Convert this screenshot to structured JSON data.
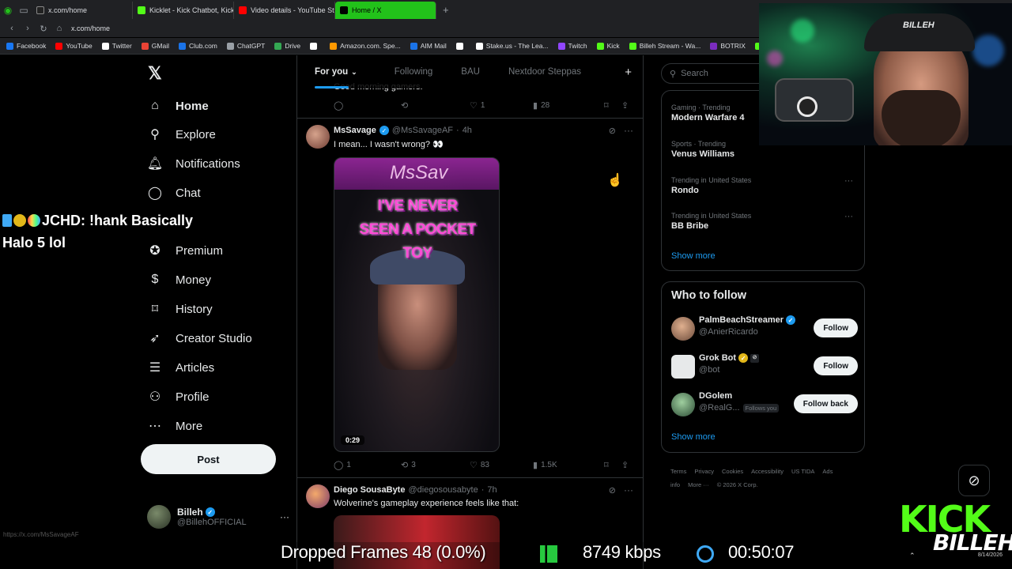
{
  "browser": {
    "tabs": [
      {
        "label": "x.com/home",
        "color": "#9aa0a6"
      },
      {
        "label": "Kicklet - Kick Chatbot, Kick",
        "color": "#53fc18"
      },
      {
        "label": "Video details - YouTube Stu",
        "color": "#ff0000"
      },
      {
        "label": "Home / X",
        "color": "#000000",
        "active": true
      }
    ],
    "url": "x.com/home",
    "bookmarks": [
      {
        "label": "Facebook",
        "color": "#1877f2"
      },
      {
        "label": "YouTube",
        "color": "#ff0000"
      },
      {
        "label": "Twitter",
        "color": "#ffffff"
      },
      {
        "label": "GMail",
        "color": "#ea4335"
      },
      {
        "label": "Club.com",
        "color": "#1a73e8"
      },
      {
        "label": "ChatGPT",
        "color": "#9aa0a6"
      },
      {
        "label": "Drive",
        "color": "#34a853"
      },
      {
        "label": "",
        "color": "#ffffff"
      },
      {
        "label": "Amazon.com. Spe...",
        "color": "#ff9900"
      },
      {
        "label": "AIM Mail",
        "color": "#1a73e8"
      },
      {
        "label": "",
        "color": "#ffffff"
      },
      {
        "label": "Stake.us - The Lea...",
        "color": "#ffffff"
      },
      {
        "label": "Twitch",
        "color": "#9146ff"
      },
      {
        "label": "Kick",
        "color": "#53fc18"
      },
      {
        "label": "Billeh Stream - Wa...",
        "color": "#53fc18"
      },
      {
        "label": "BOTRIX",
        "color": "#7b2cbf"
      },
      {
        "label": "Ki",
        "color": "#53fc18"
      }
    ]
  },
  "nav": {
    "items": [
      {
        "label": "Home",
        "icon": "home-icon",
        "glyph": "⌂",
        "active": true
      },
      {
        "label": "Explore",
        "icon": "search-icon",
        "glyph": "⚲"
      },
      {
        "label": "Notifications",
        "icon": "bell-icon",
        "glyph": "🔔︎"
      },
      {
        "label": "Chat",
        "icon": "chat-icon",
        "glyph": "◯"
      },
      {
        "label": "",
        "icon": "grok-icon",
        "glyph": ""
      },
      {
        "label": "Premium",
        "icon": "premium-icon",
        "glyph": "✪"
      },
      {
        "label": "Money",
        "icon": "money-icon",
        "glyph": "$"
      },
      {
        "label": "History",
        "icon": "bookmark-icon",
        "glyph": "⌑"
      },
      {
        "label": "Creator Studio",
        "icon": "rocket-icon",
        "glyph": "➶"
      },
      {
        "label": "Articles",
        "icon": "article-icon",
        "glyph": "☰"
      },
      {
        "label": "Profile",
        "icon": "profile-icon",
        "glyph": "⚇"
      },
      {
        "label": "More",
        "icon": "more-icon",
        "glyph": "⋯"
      }
    ],
    "post_label": "Post",
    "account": {
      "name": "Billeh",
      "handle": "@BillehOFFICIAL"
    }
  },
  "chat_overlay": {
    "line1": "JCHD: !hank Basically",
    "line2": "Halo 5 lol"
  },
  "feed": {
    "tabs": [
      "For you",
      "Following",
      "BAU",
      "Nextdoor Steppas"
    ],
    "prev_text": "Good morning gamers.",
    "prev_actions": {
      "replies": "",
      "reposts": "",
      "likes": "1",
      "views": "28"
    },
    "tweet1": {
      "name": "MsSavage",
      "handle": "@MsSavageAF",
      "time": "4h",
      "text": "I mean... I wasn't wrong? 👀",
      "media_caption": "I'VE NEVER SEEN A POCKET TOY",
      "media_title": "MsSav",
      "duration": "0:29",
      "actions": {
        "replies": "1",
        "reposts": "3",
        "likes": "83",
        "views": "1.5K"
      }
    },
    "tweet2": {
      "name": "Diego SousaByte",
      "handle": "@diegosousabyte",
      "time": "7h",
      "text": "Wolverine's gameplay experience feels like that:"
    }
  },
  "right": {
    "search_placeholder": "Search",
    "trends": [
      {
        "category": "Gaming · Trending",
        "name": "Modern Warfare 4"
      },
      {
        "category": "Sports · Trending",
        "name": "Venus Williams"
      },
      {
        "category": "Trending in United States",
        "name": "Rondo"
      },
      {
        "category": "Trending in United States",
        "name": "BB Bribe"
      }
    ],
    "show_more": "Show more",
    "who_to_follow": {
      "title": "Who to follow",
      "users": [
        {
          "name": "PalmBeachStreamer",
          "handle": "@AnierRicardo",
          "button": "Follow",
          "color": "#6b4a3a"
        },
        {
          "name": "Grok Bot",
          "handle": "@bot",
          "button": "Follow",
          "color": "#e7e9ea"
        },
        {
          "name": "DGolem",
          "handle": "@RealG...",
          "follows_you": "Follows you",
          "button": "Follow back",
          "color": "#3a6a4a"
        }
      ],
      "show_more": "Show more"
    },
    "footer": [
      "Terms",
      "Privacy",
      "Cookies",
      "Accessibility",
      "US TIDA",
      "Ads info",
      "More ···",
      "© 2026 X Corp."
    ]
  },
  "stream": {
    "dropped_frames": "Dropped Frames 48 (0.0%)",
    "bitrate": "8749 kbps",
    "uptime": "00:50:07",
    "kick_logo": "KICK",
    "kick_sub": "BILLEH",
    "date": "8/14/2026",
    "status_url": "https://x.com/MsSavageAF"
  }
}
